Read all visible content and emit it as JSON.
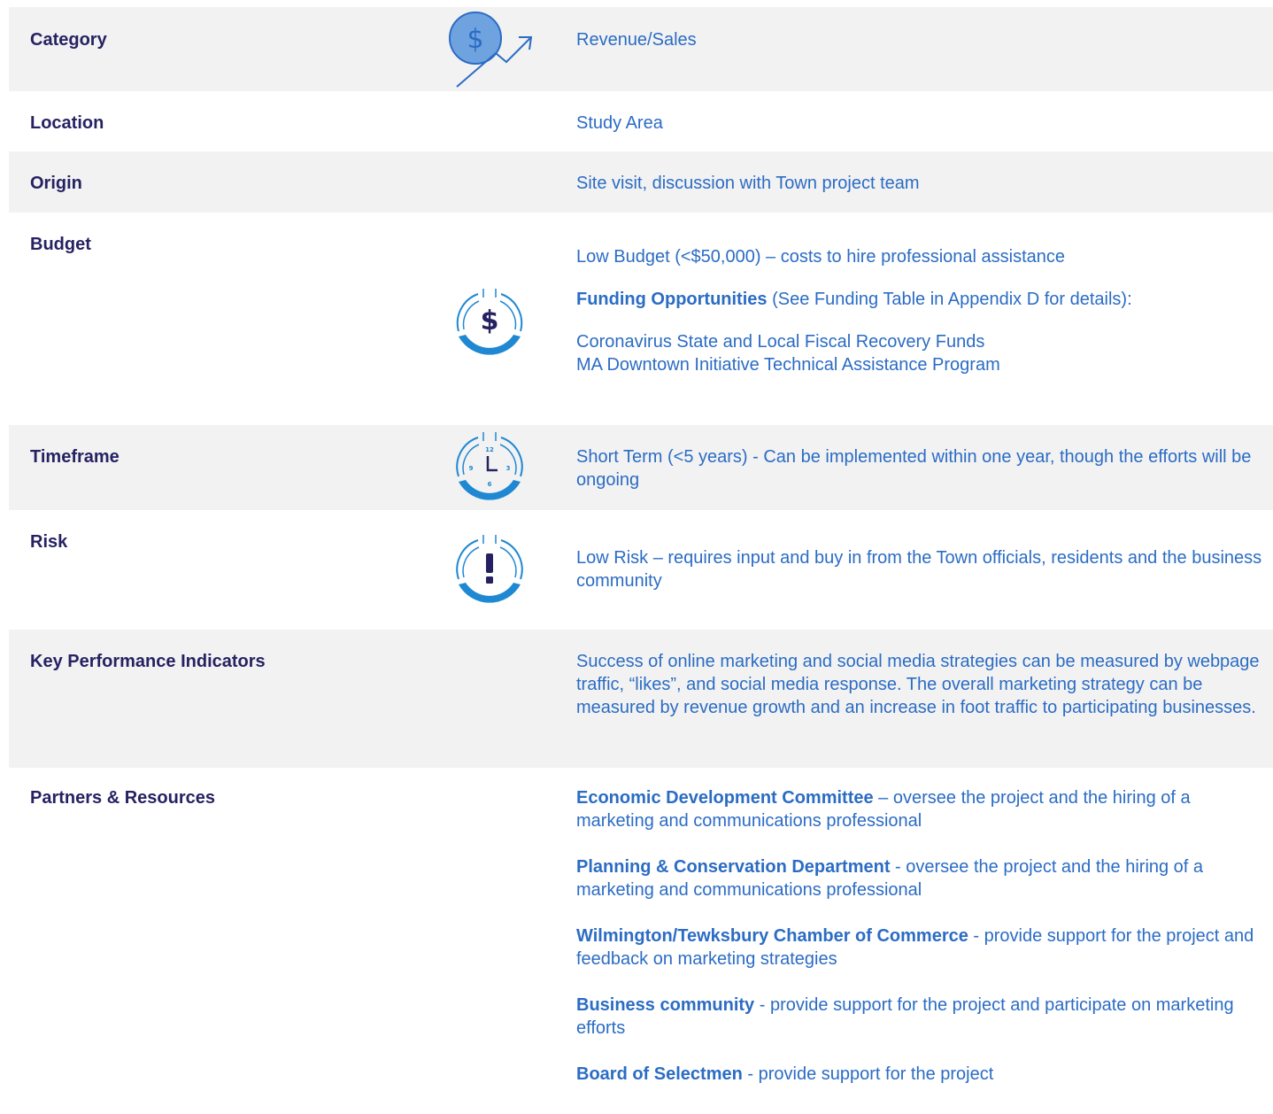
{
  "rows": {
    "category": {
      "label": "Category",
      "value": "Revenue/Sales",
      "icon": "revenue-growth-icon"
    },
    "location": {
      "label": "Location",
      "value": "Study Area"
    },
    "origin": {
      "label": "Origin",
      "value": "Site visit, discussion with Town project team"
    },
    "budget": {
      "label": "Budget",
      "icon": "budget-dollar-gauge-icon",
      "level": "Low Budget (<$50,000) – costs to hire professional assistance",
      "funding_heading": "Funding Opportunities",
      "funding_note": " (See Funding Table in Appendix D for details):",
      "funding_items": [
        "Coronavirus State and Local Fiscal Recovery Funds",
        "MA Downtown Initiative Technical Assistance Program"
      ]
    },
    "timeframe": {
      "label": "Timeframe",
      "icon": "timeframe-clock-gauge-icon",
      "clock_numbers": [
        "12",
        "3",
        "6",
        "9"
      ],
      "value": "Short Term (<5 years) - Can be implemented within one year, though the efforts will be ongoing"
    },
    "risk": {
      "label": "Risk",
      "icon": "risk-exclamation-gauge-icon",
      "value": "Low Risk – requires input and buy in from the Town officials, residents and the business community"
    },
    "kpi": {
      "label": "Key Performance Indicators",
      "value": "Success of online marketing and social media strategies can be measured by webpage traffic, “likes”, and social media response. The overall marketing strategy can be measured by revenue growth and an increase in foot traffic to participating businesses."
    },
    "partners": {
      "label": "Partners & Resources",
      "items": [
        {
          "name": "Economic Development Committee",
          "desc": " – oversee the project and the hiring of a marketing and communications professional"
        },
        {
          "name": "Planning & Conservation Department",
          "desc": " - oversee the project and the hiring of a marketing and communications professional"
        },
        {
          "name": "Wilmington/Tewksbury Chamber of Commerce",
          "desc": " - provide support for the project and feedback on marketing strategies"
        },
        {
          "name": "Business community",
          "desc": " - provide support for the project and participate on marketing efforts"
        },
        {
          "name": "Board of Selectmen",
          "desc": " - provide support for the project"
        }
      ]
    }
  },
  "colors": {
    "label": "#262262",
    "value": "#2b6cc4",
    "accent": "#1f88d2",
    "row_shade": "#f2f2f2"
  }
}
